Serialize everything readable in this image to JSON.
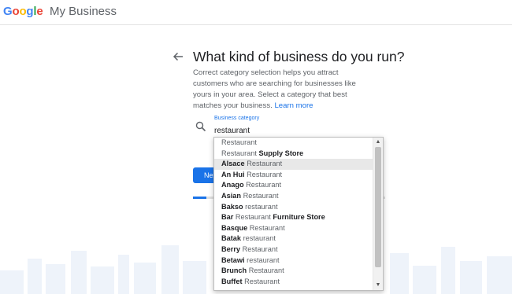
{
  "header": {
    "logo_letters": [
      {
        "ch": "G",
        "color": "#4285F4"
      },
      {
        "ch": "o",
        "color": "#EA4335"
      },
      {
        "ch": "o",
        "color": "#FBBC05"
      },
      {
        "ch": "g",
        "color": "#4285F4"
      },
      {
        "ch": "l",
        "color": "#34A853"
      },
      {
        "ch": "e",
        "color": "#EA4335"
      }
    ],
    "product": "My Business"
  },
  "main": {
    "title": "What kind of business do you run?",
    "description": "Correct category selection helps you attract customers who are searching for businesses like yours in your area. Select a category that best matches your business.",
    "learn_more": "Learn more",
    "field_label": "Business category",
    "field_value": "restaurant",
    "next_label": "Next",
    "progress_fraction": 0.07
  },
  "dropdown": {
    "items": [
      {
        "parts": [
          {
            "t": "Restaurant",
            "b": false
          }
        ]
      },
      {
        "parts": [
          {
            "t": "Restaurant",
            "b": false
          },
          {
            "t": " Supply Store",
            "b": true
          }
        ]
      },
      {
        "parts": [
          {
            "t": "Alsace",
            "b": true
          },
          {
            "t": " Restaurant",
            "b": false
          }
        ]
      },
      {
        "parts": [
          {
            "t": "An Hui",
            "b": true
          },
          {
            "t": " Restaurant",
            "b": false
          }
        ]
      },
      {
        "parts": [
          {
            "t": "Anago",
            "b": true
          },
          {
            "t": " Restaurant",
            "b": false
          }
        ]
      },
      {
        "parts": [
          {
            "t": "Asian",
            "b": true
          },
          {
            "t": " Restaurant",
            "b": false
          }
        ]
      },
      {
        "parts": [
          {
            "t": "Bakso",
            "b": true
          },
          {
            "t": " restaurant",
            "b": false
          }
        ]
      },
      {
        "parts": [
          {
            "t": "Bar",
            "b": true
          },
          {
            "t": " Restaurant",
            "b": false
          },
          {
            "t": " Furniture Store",
            "b": true
          }
        ]
      },
      {
        "parts": [
          {
            "t": "Basque",
            "b": true
          },
          {
            "t": " Restaurant",
            "b": false
          }
        ]
      },
      {
        "parts": [
          {
            "t": "Batak",
            "b": true
          },
          {
            "t": " restaurant",
            "b": false
          }
        ]
      },
      {
        "parts": [
          {
            "t": "Berry",
            "b": true
          },
          {
            "t": " Restaurant",
            "b": false
          }
        ]
      },
      {
        "parts": [
          {
            "t": "Betawi",
            "b": true
          },
          {
            "t": " restaurant",
            "b": false
          }
        ]
      },
      {
        "parts": [
          {
            "t": "Brunch",
            "b": true
          },
          {
            "t": " Restaurant",
            "b": false
          }
        ]
      },
      {
        "parts": [
          {
            "t": "Buffet",
            "b": true
          },
          {
            "t": " Restaurant",
            "b": false
          }
        ]
      }
    ],
    "highlighted_index": 2
  }
}
